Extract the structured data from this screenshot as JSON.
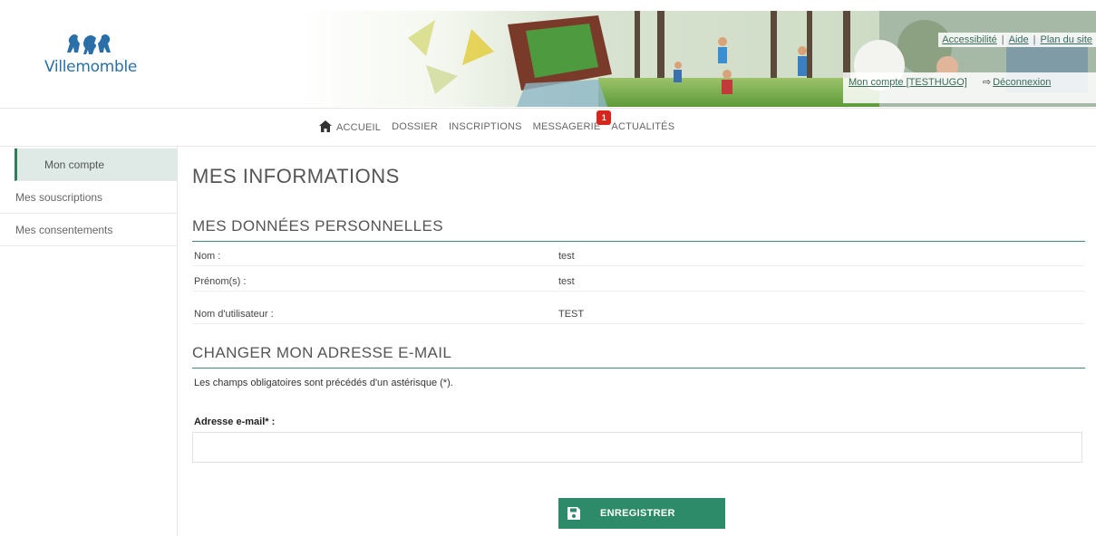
{
  "header": {
    "logo_text": "Villemomble",
    "util_links": [
      "Accessibilité",
      "Aide",
      "Plan du site"
    ],
    "account_link": "Mon compte [TESTHUGO]",
    "logout_link": "Déconnexion"
  },
  "nav": {
    "items": [
      "ACCUEIL",
      "DOSSIER",
      "INSCRIPTIONS",
      "MESSAGERIE",
      "ACTUALITÉS"
    ],
    "messagerie_badge": "1"
  },
  "sidebar": {
    "items": [
      {
        "label": "Mon compte",
        "active": true
      },
      {
        "label": "Mes souscriptions",
        "active": false
      },
      {
        "label": "Mes consentements",
        "active": false
      }
    ]
  },
  "main": {
    "page_title": "MES INFORMATIONS",
    "personal_section_title": "MES DONNÉES PERSONNELLES",
    "fields": [
      {
        "label": "Nom :",
        "value": "test"
      },
      {
        "label": "Prénom(s) :",
        "value": "test"
      },
      {
        "label": "Nom d'utilisateur :",
        "value": "TEST"
      }
    ],
    "email_section_title": "CHANGER MON ADRESSE E-MAIL",
    "required_note": "Les champs obligatoires sont précédés d'un astérisque (*).",
    "email_label": "Adresse e-mail* :",
    "email_value": "",
    "save_label": "ENREGISTRER"
  },
  "colors": {
    "accent": "#2e8b6a",
    "link": "#3a6b5a",
    "badge": "#d9261c",
    "logo": "#2a6fa8"
  }
}
